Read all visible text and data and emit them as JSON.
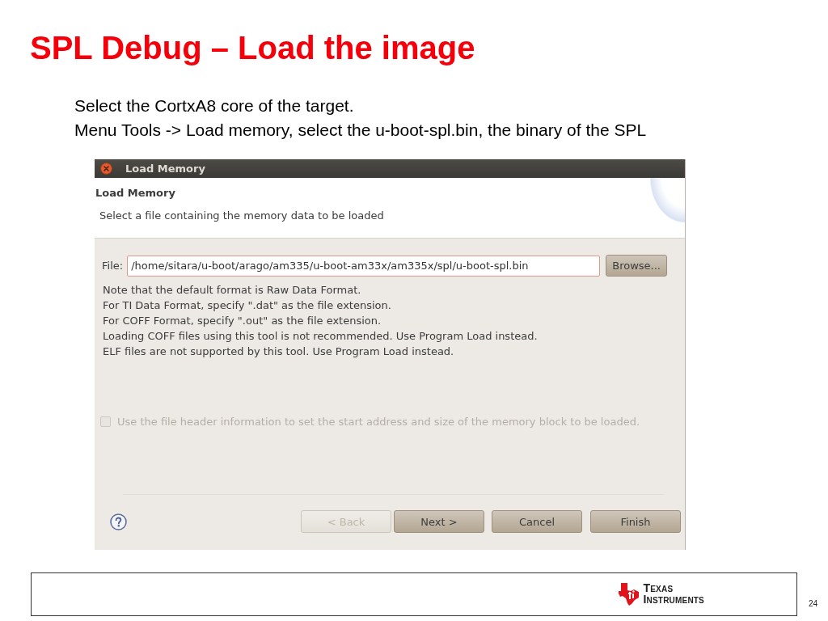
{
  "slide": {
    "title": "SPL Debug – Load the image",
    "lines": [
      "Select the CortxA8 core of the target.",
      "Menu Tools -> Load memory, select the u-boot-spl.bin, the binary of the SPL"
    ]
  },
  "dialog": {
    "window_title": "Load Memory",
    "heading": "Load Memory",
    "description": "Select a file containing the memory data to be loaded",
    "file": {
      "label": "File:",
      "value": "/home/sitara/u-boot/arago/am335/u-boot-am33x/am335x/spl/u-boot-spl.bin",
      "browse_button": "Browse..."
    },
    "notes": [
      "Note that the default format is Raw Data Format.",
      "For TI Data Format, specify \".dat\" as the file extension.",
      "For COFF Format, specify \".out\" as the file extension.",
      "Loading COFF files using this tool is not recommended. Use Program Load instead.",
      "ELF files are not supported by this tool. Use Program Load instead."
    ],
    "checkbox": {
      "label": "Use the file header information to set the start address and size of the memory block to be loaded.",
      "checked": false,
      "disabled": true
    },
    "buttons": [
      {
        "label": "< Back",
        "disabled": true
      },
      {
        "label": "Next >",
        "disabled": false
      },
      {
        "label": "Cancel",
        "disabled": false
      },
      {
        "label": "Finish",
        "disabled": false
      }
    ]
  },
  "footer": {
    "logo": [
      "TEXAS",
      "INSTRUMENTS"
    ],
    "page_number": "24"
  }
}
